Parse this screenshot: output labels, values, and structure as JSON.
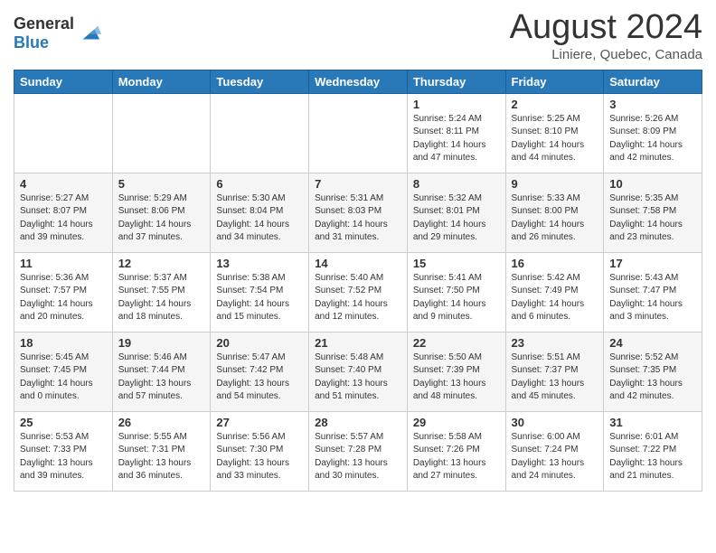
{
  "header": {
    "logo_general": "General",
    "logo_blue": "Blue",
    "month_title": "August 2024",
    "location": "Liniere, Quebec, Canada"
  },
  "weekdays": [
    "Sunday",
    "Monday",
    "Tuesday",
    "Wednesday",
    "Thursday",
    "Friday",
    "Saturday"
  ],
  "weeks": [
    [
      {
        "day": "",
        "content": ""
      },
      {
        "day": "",
        "content": ""
      },
      {
        "day": "",
        "content": ""
      },
      {
        "day": "",
        "content": ""
      },
      {
        "day": "1",
        "content": "Sunrise: 5:24 AM\nSunset: 8:11 PM\nDaylight: 14 hours\nand 47 minutes."
      },
      {
        "day": "2",
        "content": "Sunrise: 5:25 AM\nSunset: 8:10 PM\nDaylight: 14 hours\nand 44 minutes."
      },
      {
        "day": "3",
        "content": "Sunrise: 5:26 AM\nSunset: 8:09 PM\nDaylight: 14 hours\nand 42 minutes."
      }
    ],
    [
      {
        "day": "4",
        "content": "Sunrise: 5:27 AM\nSunset: 8:07 PM\nDaylight: 14 hours\nand 39 minutes."
      },
      {
        "day": "5",
        "content": "Sunrise: 5:29 AM\nSunset: 8:06 PM\nDaylight: 14 hours\nand 37 minutes."
      },
      {
        "day": "6",
        "content": "Sunrise: 5:30 AM\nSunset: 8:04 PM\nDaylight: 14 hours\nand 34 minutes."
      },
      {
        "day": "7",
        "content": "Sunrise: 5:31 AM\nSunset: 8:03 PM\nDaylight: 14 hours\nand 31 minutes."
      },
      {
        "day": "8",
        "content": "Sunrise: 5:32 AM\nSunset: 8:01 PM\nDaylight: 14 hours\nand 29 minutes."
      },
      {
        "day": "9",
        "content": "Sunrise: 5:33 AM\nSunset: 8:00 PM\nDaylight: 14 hours\nand 26 minutes."
      },
      {
        "day": "10",
        "content": "Sunrise: 5:35 AM\nSunset: 7:58 PM\nDaylight: 14 hours\nand 23 minutes."
      }
    ],
    [
      {
        "day": "11",
        "content": "Sunrise: 5:36 AM\nSunset: 7:57 PM\nDaylight: 14 hours\nand 20 minutes."
      },
      {
        "day": "12",
        "content": "Sunrise: 5:37 AM\nSunset: 7:55 PM\nDaylight: 14 hours\nand 18 minutes."
      },
      {
        "day": "13",
        "content": "Sunrise: 5:38 AM\nSunset: 7:54 PM\nDaylight: 14 hours\nand 15 minutes."
      },
      {
        "day": "14",
        "content": "Sunrise: 5:40 AM\nSunset: 7:52 PM\nDaylight: 14 hours\nand 12 minutes."
      },
      {
        "day": "15",
        "content": "Sunrise: 5:41 AM\nSunset: 7:50 PM\nDaylight: 14 hours\nand 9 minutes."
      },
      {
        "day": "16",
        "content": "Sunrise: 5:42 AM\nSunset: 7:49 PM\nDaylight: 14 hours\nand 6 minutes."
      },
      {
        "day": "17",
        "content": "Sunrise: 5:43 AM\nSunset: 7:47 PM\nDaylight: 14 hours\nand 3 minutes."
      }
    ],
    [
      {
        "day": "18",
        "content": "Sunrise: 5:45 AM\nSunset: 7:45 PM\nDaylight: 14 hours\nand 0 minutes."
      },
      {
        "day": "19",
        "content": "Sunrise: 5:46 AM\nSunset: 7:44 PM\nDaylight: 13 hours\nand 57 minutes."
      },
      {
        "day": "20",
        "content": "Sunrise: 5:47 AM\nSunset: 7:42 PM\nDaylight: 13 hours\nand 54 minutes."
      },
      {
        "day": "21",
        "content": "Sunrise: 5:48 AM\nSunset: 7:40 PM\nDaylight: 13 hours\nand 51 minutes."
      },
      {
        "day": "22",
        "content": "Sunrise: 5:50 AM\nSunset: 7:39 PM\nDaylight: 13 hours\nand 48 minutes."
      },
      {
        "day": "23",
        "content": "Sunrise: 5:51 AM\nSunset: 7:37 PM\nDaylight: 13 hours\nand 45 minutes."
      },
      {
        "day": "24",
        "content": "Sunrise: 5:52 AM\nSunset: 7:35 PM\nDaylight: 13 hours\nand 42 minutes."
      }
    ],
    [
      {
        "day": "25",
        "content": "Sunrise: 5:53 AM\nSunset: 7:33 PM\nDaylight: 13 hours\nand 39 minutes."
      },
      {
        "day": "26",
        "content": "Sunrise: 5:55 AM\nSunset: 7:31 PM\nDaylight: 13 hours\nand 36 minutes."
      },
      {
        "day": "27",
        "content": "Sunrise: 5:56 AM\nSunset: 7:30 PM\nDaylight: 13 hours\nand 33 minutes."
      },
      {
        "day": "28",
        "content": "Sunrise: 5:57 AM\nSunset: 7:28 PM\nDaylight: 13 hours\nand 30 minutes."
      },
      {
        "day": "29",
        "content": "Sunrise: 5:58 AM\nSunset: 7:26 PM\nDaylight: 13 hours\nand 27 minutes."
      },
      {
        "day": "30",
        "content": "Sunrise: 6:00 AM\nSunset: 7:24 PM\nDaylight: 13 hours\nand 24 minutes."
      },
      {
        "day": "31",
        "content": "Sunrise: 6:01 AM\nSunset: 7:22 PM\nDaylight: 13 hours\nand 21 minutes."
      }
    ]
  ]
}
